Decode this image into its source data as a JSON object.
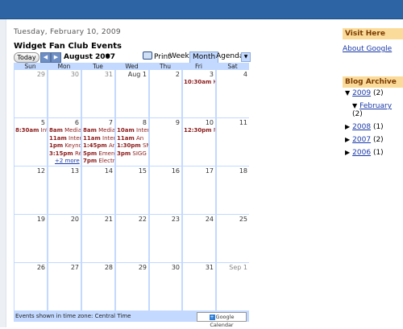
{
  "post": {
    "date": "Tuesday, February 10, 2009",
    "title": "Widget Fan Club Events"
  },
  "calendar": {
    "today_label": "Today",
    "month_label": "August 2007",
    "print_label": "Print",
    "tabs": [
      "Week",
      "Month",
      "Agenda"
    ],
    "active_tab": "Month",
    "weekdays": [
      "Sun",
      "Mon",
      "Tue",
      "Wed",
      "Thu",
      "Fri",
      "Sat"
    ],
    "weeks": [
      [
        {
          "d": "29",
          "other": true
        },
        {
          "d": "30",
          "other": true
        },
        {
          "d": "31",
          "other": true
        },
        {
          "d": "Aug 1"
        },
        {
          "d": "2"
        },
        {
          "d": "3"
        },
        {
          "d": "4"
        }
      ],
      [
        {
          "d": "5"
        },
        {
          "d": "6"
        },
        {
          "d": "7"
        },
        {
          "d": "8"
        },
        {
          "d": "9"
        },
        {
          "d": "10"
        },
        {
          "d": "11"
        }
      ],
      [
        {
          "d": "12"
        },
        {
          "d": "13"
        },
        {
          "d": "14"
        },
        {
          "d": "15"
        },
        {
          "d": "16"
        },
        {
          "d": "17"
        },
        {
          "d": "18"
        }
      ],
      [
        {
          "d": "19"
        },
        {
          "d": "20"
        },
        {
          "d": "21"
        },
        {
          "d": "22"
        },
        {
          "d": "23"
        },
        {
          "d": "24"
        },
        {
          "d": "25"
        }
      ],
      [
        {
          "d": "26"
        },
        {
          "d": "27"
        },
        {
          "d": "28"
        },
        {
          "d": "29"
        },
        {
          "d": "30"
        },
        {
          "d": "31"
        },
        {
          "d": "Sep 1",
          "other": true
        }
      ]
    ],
    "events": {
      "0-5": [
        {
          "time": "10:30am",
          "title": "Kan"
        }
      ],
      "1-0": [
        {
          "time": "8:30am",
          "title": "Intro"
        }
      ],
      "1-1": [
        {
          "time": "8am",
          "title": "Media R"
        },
        {
          "time": "11am",
          "title": "Intervi"
        },
        {
          "time": "1pm",
          "title": "Keynote"
        },
        {
          "time": "3:15pm",
          "title": "Résu"
        }
      ],
      "1-2": [
        {
          "time": "8am",
          "title": "Media B"
        },
        {
          "time": "11am",
          "title": "Intervi"
        },
        {
          "time": "1:45pm",
          "title": "Anyo"
        },
        {
          "time": "5pm",
          "title": "Emergi"
        },
        {
          "time": "7pm",
          "title": "Electron"
        }
      ],
      "1-3": [
        {
          "time": "10am",
          "title": "Intervi"
        },
        {
          "time": "11am",
          "title": "An"
        },
        {
          "time": "1:30pm",
          "title": "SMIL"
        },
        {
          "time": "3pm",
          "title": "SIGG"
        }
      ],
      "1-5": [
        {
          "time": "12:30pm",
          "title": "Fly I"
        }
      ]
    },
    "more_link": "+2 more",
    "timezone_note": "Events shown in time zone: Central Time",
    "gcal_label": "Google Calendar"
  },
  "sidebar": {
    "visit_heading": "Visit Here",
    "visit_link": "About Google",
    "archive_heading": "Blog Archive",
    "archive": [
      {
        "year": "2009",
        "count": "(2)",
        "open": true,
        "months": [
          {
            "name": "February",
            "count": "(2)"
          }
        ]
      },
      {
        "year": "2008",
        "count": "(1)"
      },
      {
        "year": "2007",
        "count": "(2)"
      },
      {
        "year": "2006",
        "count": "(1)"
      }
    ]
  },
  "colors": {
    "topbar": "#2d64a4",
    "calendar_border": "#c3d9ff",
    "event_text": "#8b1a1a",
    "sidebar_heading": "#fbdb9a",
    "link": "#1a39a8"
  }
}
